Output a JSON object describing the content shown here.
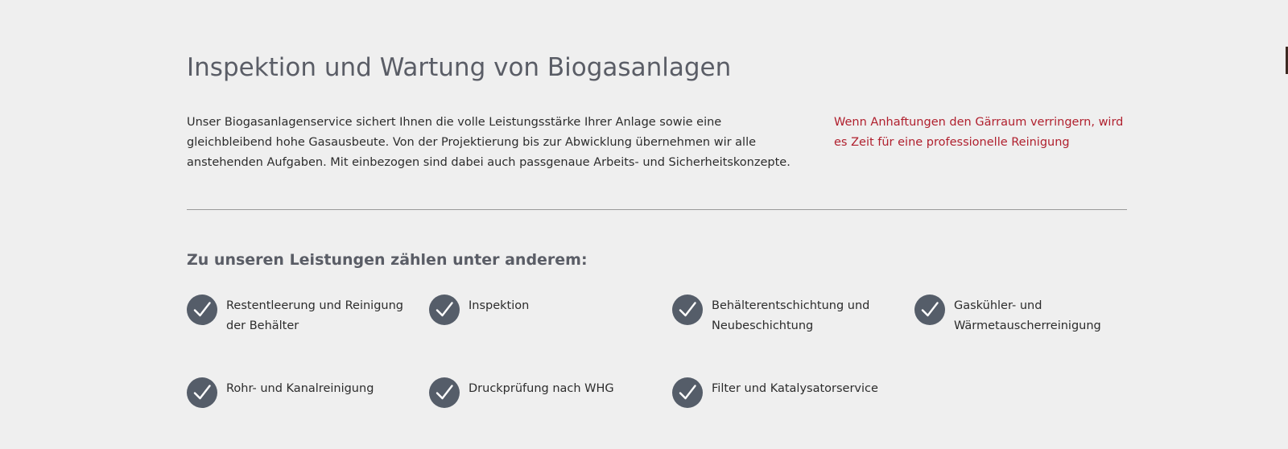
{
  "page": {
    "title": "Inspektion und Wartung von Biogasanlagen",
    "intro": "Unser Biogasanlagenservice sichert Ihnen die volle Leistungsstärke Ihrer Anlage sowie eine gleichbleibend hohe Gasausbeute. Von der Projektierung bis zur Abwicklung übernehmen wir alle anstehenden Aufgaben. Mit einbezogen sind dabei auch passgenaue Arbeits- und Sicherheitskonzepte.",
    "teaser_link": "Wenn Anhaftungen den Gärraum verringern, wird es Zeit für eine professionelle Reinigung"
  },
  "services": {
    "heading": "Zu unseren Leistungen zählen unter anderem:",
    "icon": "check-icon",
    "items": [
      {
        "label": "Restentleerung und Reinigung der Behälter"
      },
      {
        "label": "Inspektion"
      },
      {
        "label": "Behälterentschichtung und Neubeschichtung"
      },
      {
        "label": "Gaskühler- und Wärmetauscherreinigung"
      },
      {
        "label": "Rohr- und Kanalreinigung"
      },
      {
        "label": "Druckprüfung nach WHG"
      },
      {
        "label": "Filter und Katalysatorservice"
      }
    ]
  },
  "colors": {
    "background": "#efefef",
    "title": "#5a5d66",
    "body_text": "#2c2c2c",
    "link": "#b0202e",
    "icon_circle": "#555d69",
    "divider": "#9a9a9a"
  }
}
